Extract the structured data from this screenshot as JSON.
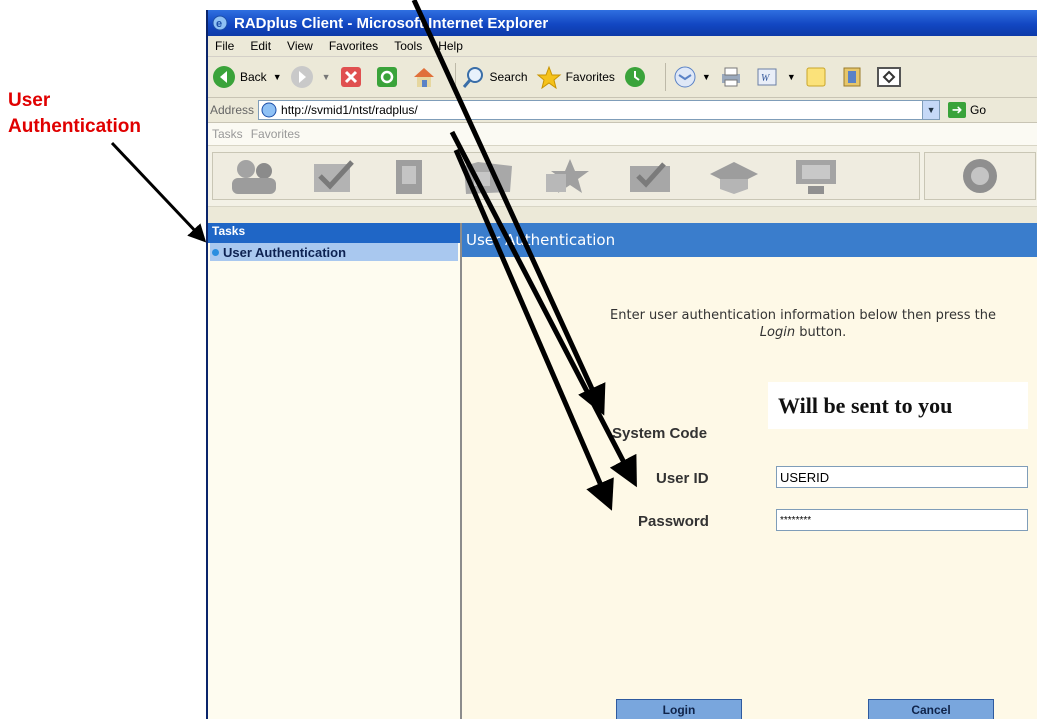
{
  "annotation": {
    "label_line1": "User",
    "label_line2": "Authentication"
  },
  "window": {
    "title": "RADplus Client - Microsoft Internet Explorer",
    "menu": [
      "File",
      "Edit",
      "View",
      "Favorites",
      "Tools",
      "Help"
    ],
    "toolbar": {
      "back": "Back",
      "search": "Search",
      "favorites": "Favorites"
    },
    "address": {
      "label": "Address",
      "url": "http://svmid1/ntst/radplus/",
      "go": "Go"
    }
  },
  "app": {
    "menu": [
      "Tasks",
      "Favorites"
    ],
    "sidebar": {
      "header": "Tasks",
      "items": [
        {
          "label": "User Authentication"
        }
      ]
    },
    "main": {
      "header": "User Authentication",
      "instruction_pre": "Enter user authentication information below then press the ",
      "instruction_em": "Login",
      "instruction_post": " button.",
      "fields": {
        "system_code_label": "System Code",
        "system_code_value": "Will be sent to you",
        "user_id_label": "User ID",
        "user_id_value": "USERID",
        "password_label": "Password",
        "password_value": "********"
      },
      "buttons": {
        "login": "Login",
        "cancel": "Cancel"
      }
    }
  },
  "colors": {
    "annotation": "#e00000",
    "header_blue": "#3a7dcc",
    "sidebar_selected": "#a9c8ef"
  }
}
